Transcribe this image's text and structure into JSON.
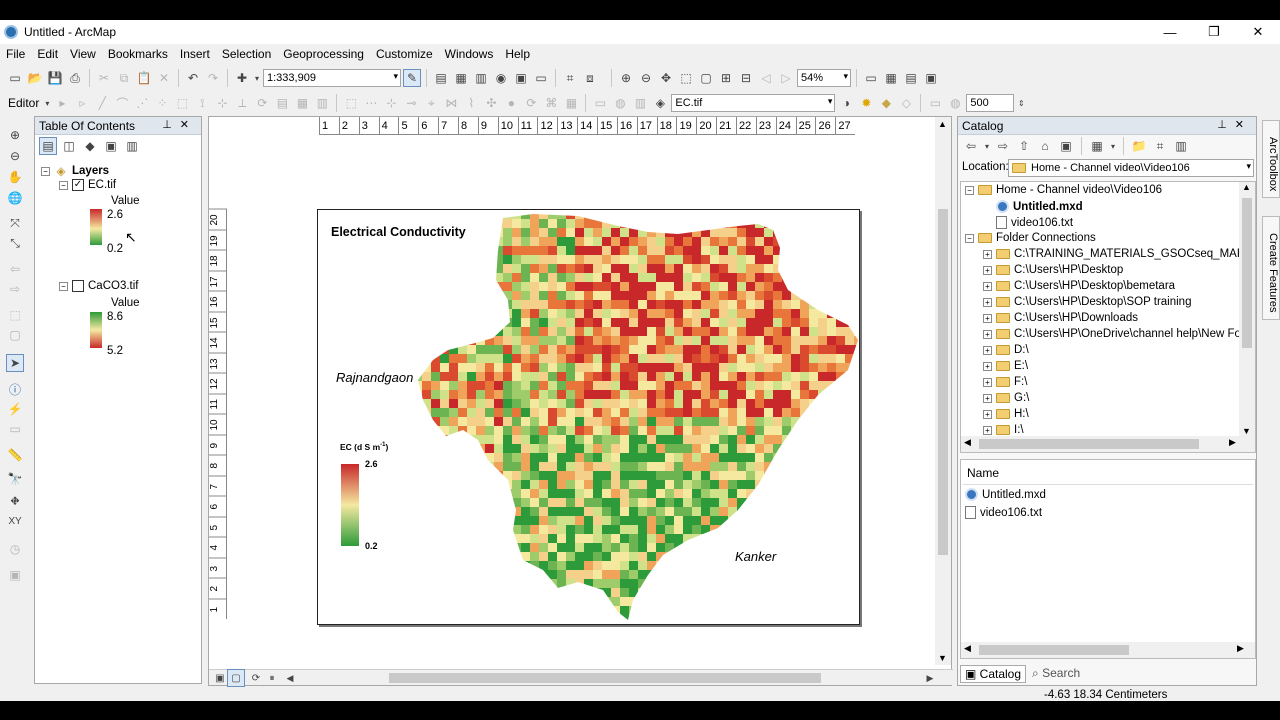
{
  "window": {
    "title": "Untitled - ArcMap",
    "minimize": "—",
    "maximize": "❐",
    "close": "✕"
  },
  "menu": [
    "File",
    "Edit",
    "View",
    "Bookmarks",
    "Insert",
    "Selection",
    "Geoprocessing",
    "Customize",
    "Windows",
    "Help"
  ],
  "toolbar": {
    "scale": "1:333,909",
    "zoom": "54%",
    "editor": "Editor",
    "layer": "EC.tif",
    "value": "500"
  },
  "toc": {
    "title": "Table Of Contents",
    "root": "Layers",
    "layers": [
      {
        "name": "EC.tif",
        "checked": true,
        "field": "Value",
        "high": "2.6",
        "low": "0.2"
      },
      {
        "name": "CaCO3.tif",
        "checked": false,
        "field": "Value",
        "high": "8.6",
        "low": "5.2"
      }
    ]
  },
  "map": {
    "title": "Electrical Conductivity",
    "label_left": "Rajnandgaon",
    "label_right": "Kanker",
    "legend_title": "EC (d S m",
    "legend_sup": "-1",
    "legend_close": ")",
    "legend_high": "2.6",
    "legend_low": "0.2"
  },
  "ruler": {
    "top": [
      "1",
      "2",
      "3",
      "4",
      "5",
      "6",
      "7",
      "8",
      "9",
      "10",
      "11",
      "12",
      "13",
      "14",
      "15",
      "16",
      "17",
      "18",
      "19",
      "20",
      "21",
      "22",
      "23",
      "24",
      "25",
      "26",
      "27"
    ],
    "left": [
      "1",
      "2",
      "3",
      "4",
      "5",
      "6",
      "7",
      "8",
      "9",
      "10",
      "11",
      "12",
      "13",
      "14",
      "15",
      "16",
      "17",
      "18",
      "19",
      "20"
    ]
  },
  "catalog": {
    "title": "Catalog",
    "location_label": "Location:",
    "location": "Home - Channel video\\Video106",
    "tree": [
      {
        "level": 0,
        "icon": "folder",
        "label": "Home - Channel video\\Video106",
        "exp": "⊟"
      },
      {
        "level": 1,
        "icon": "mxd",
        "label": "Untitled.mxd",
        "bold": true
      },
      {
        "level": 1,
        "icon": "file",
        "label": "video106.txt"
      },
      {
        "level": 0,
        "icon": "folder",
        "label": "Folder Connections",
        "exp": "⊟"
      },
      {
        "level": 1,
        "icon": "folder",
        "label": "C:\\TRAINING_MATERIALS_GSOCseq_MAPS_1",
        "exp": "⊞"
      },
      {
        "level": 1,
        "icon": "folder",
        "label": "C:\\Users\\HP\\Desktop",
        "exp": "⊞"
      },
      {
        "level": 1,
        "icon": "folder",
        "label": "C:\\Users\\HP\\Desktop\\bemetara",
        "exp": "⊞"
      },
      {
        "level": 1,
        "icon": "folder",
        "label": "C:\\Users\\HP\\Desktop\\SOP training",
        "exp": "⊞"
      },
      {
        "level": 1,
        "icon": "folder",
        "label": "C:\\Users\\HP\\Downloads",
        "exp": "⊞"
      },
      {
        "level": 1,
        "icon": "folder",
        "label": "C:\\Users\\HP\\OneDrive\\channel help\\New Fo",
        "exp": "⊞"
      },
      {
        "level": 1,
        "icon": "folder",
        "label": "D:\\",
        "exp": "⊞"
      },
      {
        "level": 1,
        "icon": "folder",
        "label": "E:\\",
        "exp": "⊞"
      },
      {
        "level": 1,
        "icon": "folder",
        "label": "F:\\",
        "exp": "⊞"
      },
      {
        "level": 1,
        "icon": "folder",
        "label": "G:\\",
        "exp": "⊞"
      },
      {
        "level": 1,
        "icon": "folder",
        "label": "H:\\",
        "exp": "⊞"
      },
      {
        "level": 1,
        "icon": "folder",
        "label": "I:\\",
        "exp": "⊞"
      }
    ],
    "list_header": "Name",
    "list": [
      {
        "icon": "mxd",
        "label": "Untitled.mxd"
      },
      {
        "icon": "file",
        "label": "video106.txt"
      }
    ],
    "tabs": [
      "Catalog",
      "Search"
    ]
  },
  "side_tabs": [
    "ArcToolbox",
    "Create Features"
  ],
  "status": "-4.63  18.34 Centimeters",
  "colors": {
    "high": "#c8282a",
    "mid": "#f5e9a0",
    "low": "#2e9b3a"
  }
}
